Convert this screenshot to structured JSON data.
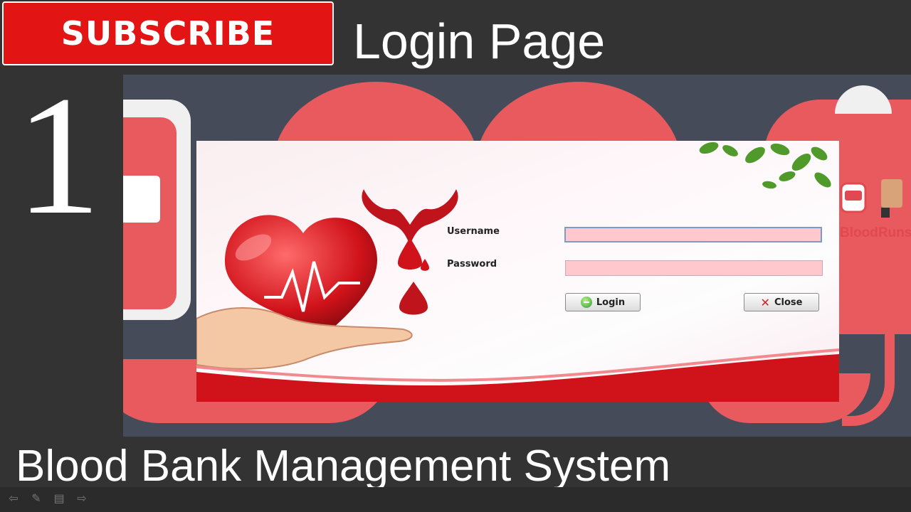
{
  "banner": {
    "subscribe_label": "SUBSCRIBE",
    "page_title": "Login Page",
    "episode_number": "1",
    "series_title": "Blood Bank Management System"
  },
  "login_form": {
    "username_label": "Username",
    "password_label": "Password",
    "username_value": "",
    "password_value": "",
    "login_button": "Login",
    "close_button": "Close"
  },
  "brand": {
    "name": "BloodRuns"
  },
  "icons": {
    "login": "login-icon",
    "close": "close-icon",
    "heart": "heart-in-hand-icon",
    "blood_drop": "blood-drop-icon",
    "leaves": "leaves-icon"
  },
  "colors": {
    "subscribe_red": "#e21414",
    "accent_red": "#e85a5e",
    "field_pink": "#ffc8cc",
    "slate": "#454b58"
  }
}
